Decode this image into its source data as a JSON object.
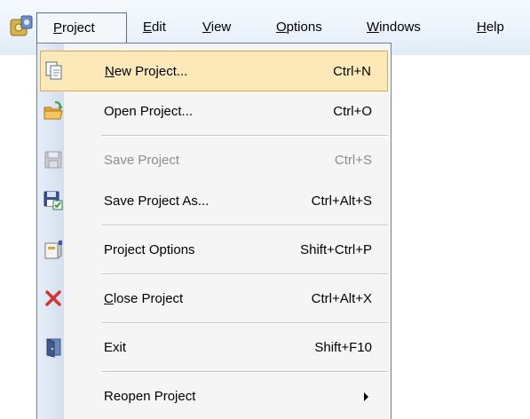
{
  "menubar": {
    "items": [
      {
        "label": "Project",
        "mnemonic": "P",
        "rest": "roject"
      },
      {
        "label": "Edit",
        "mnemonic": "E",
        "rest": "dit"
      },
      {
        "label": "View",
        "mnemonic": "V",
        "rest": "iew"
      },
      {
        "label": "Options",
        "mnemonic": "O",
        "rest": "ptions"
      },
      {
        "label": "Windows",
        "mnemonic": "W",
        "rest": "indows"
      },
      {
        "label": "Help",
        "mnemonic": "H",
        "rest": "elp"
      }
    ]
  },
  "project_menu": {
    "items": [
      {
        "label": "New Project...",
        "mnemonic": "N",
        "rest": "ew Project...",
        "shortcut": "Ctrl+N",
        "icon": "new-project-icon",
        "state": "highlighted"
      },
      {
        "label": "Open Project...",
        "shortcut": "Ctrl+O",
        "icon": "open-folder-icon",
        "state": "enabled"
      },
      {
        "label": "Save Project",
        "shortcut": "Ctrl+S",
        "icon": "save-icon",
        "state": "disabled"
      },
      {
        "label": "Save Project As...",
        "shortcut": "Ctrl+Alt+S",
        "icon": "save-as-icon",
        "state": "enabled"
      },
      {
        "label": "Project Options",
        "shortcut": "Shift+Ctrl+P",
        "icon": "project-options-icon",
        "state": "enabled"
      },
      {
        "label": "Close Project",
        "mnemonic": "C",
        "rest": "lose Project",
        "shortcut": "Ctrl+Alt+X",
        "icon": "close-icon",
        "state": "enabled"
      },
      {
        "label": "Exit",
        "shortcut": "Shift+F10",
        "icon": "exit-door-icon",
        "state": "enabled"
      },
      {
        "label": "Reopen Project",
        "shortcut": "",
        "icon": "",
        "state": "enabled",
        "has_submenu": true
      }
    ]
  },
  "colors": {
    "highlight_bg": "#fde9b8",
    "highlight_border": "#e3a850",
    "menu_bg": "#f5f5f5",
    "disabled_text": "#8d8d8d",
    "close_red": "#d9362b"
  }
}
